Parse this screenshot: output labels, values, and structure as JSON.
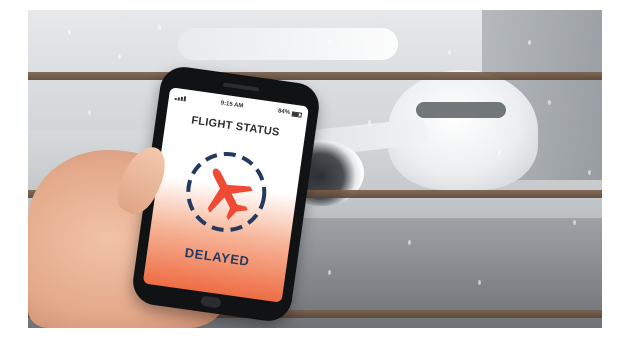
{
  "phone": {
    "status": {
      "time": "9:15 AM",
      "battery": "84%"
    },
    "title": "FLIGHT STATUS",
    "status_label": "DELAYED",
    "icon": "airplane-icon",
    "colors": {
      "accent": "#ee4a34",
      "ring": "#24395f",
      "label": "#24395f"
    }
  }
}
